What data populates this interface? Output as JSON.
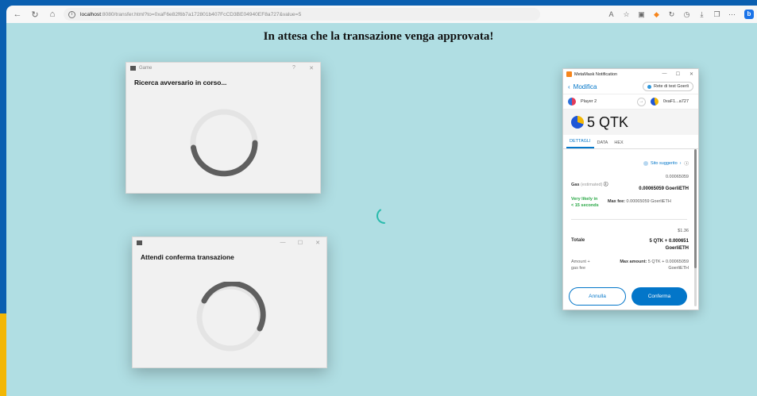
{
  "browser": {
    "url_host": "localhost",
    "url_rest": ":8080/transfer.html?to=0xaF6e82f6b7a172801b407FcCD3BE04940EF8a727&value=5"
  },
  "page": {
    "heading": "In attesa che la transazione venga approvata!"
  },
  "game_dialog": {
    "title": "Game",
    "help_label": "?",
    "close_label": "✕",
    "message": "Ricerca avversario in corso..."
  },
  "confirm_dialog": {
    "minimize_label": "—",
    "maximize_label": "☐",
    "close_label": "✕",
    "message": "Attendi conferma transazione"
  },
  "metamask": {
    "window_title": "MetaMask Notification",
    "back_label": "Modifica",
    "network": "Rete di test Goerli",
    "from_account": "Player 2",
    "to_account": "0xaF1...a727",
    "amount": "5 QTK",
    "tabs": [
      "DETTAGLI",
      "DATA",
      "HEX"
    ],
    "suggested_site": "Sito suggerito",
    "gas_small": "0.00065059",
    "gas_label": "Gas",
    "gas_estimated": "(estimated)",
    "gas_big": "0.00065059 GoerliETH",
    "likely": "Very likely in < 15 seconds",
    "max_fee_label": "Max fee:",
    "max_fee_value": "0.00065059 GoerliETH",
    "total_small": "$1.36",
    "total_label": "Totale",
    "total_big": "5 QTK + 0.000651 GoerliETH",
    "amount_gas_label": "Amount + gas fee",
    "max_amount_label": "Max amount:",
    "max_amount_value": "5 QTK + 0.00065059 GoerliETH",
    "cancel_label": "Annulla",
    "confirm_label": "Conferma"
  },
  "colors": {
    "page_bg": "#b0dee3",
    "accent_blue": "#0376c9",
    "spinner_teal": "#2bbbad",
    "spinner_dark": "#5f5f5f"
  }
}
